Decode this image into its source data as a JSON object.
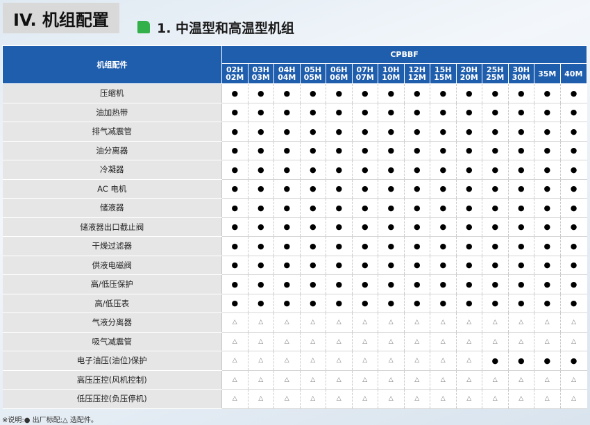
{
  "header": {
    "section": "IV. 机组配置",
    "subtitle": "1. 中温型和高温型机组"
  },
  "table": {
    "corner": "机组配件",
    "group": "CPBBF",
    "models": [
      [
        "02H",
        "02M"
      ],
      [
        "03H",
        "03M"
      ],
      [
        "04H",
        "04M"
      ],
      [
        "05H",
        "05M"
      ],
      [
        "06H",
        "06M"
      ],
      [
        "07H",
        "07M"
      ],
      [
        "10H",
        "10M"
      ],
      [
        "12H",
        "12M"
      ],
      [
        "15H",
        "15M"
      ],
      [
        "20H",
        "20M"
      ],
      [
        "25H",
        "25M"
      ],
      [
        "30H",
        "30M"
      ],
      [
        "35M"
      ],
      [
        "40M"
      ]
    ],
    "rows": [
      {
        "label": "压缩机",
        "cells": [
          "●",
          "●",
          "●",
          "●",
          "●",
          "●",
          "●",
          "●",
          "●",
          "●",
          "●",
          "●",
          "●",
          "●"
        ]
      },
      {
        "label": "油加热带",
        "cells": [
          "●",
          "●",
          "●",
          "●",
          "●",
          "●",
          "●",
          "●",
          "●",
          "●",
          "●",
          "●",
          "●",
          "●"
        ]
      },
      {
        "label": "排气减震管",
        "cells": [
          "●",
          "●",
          "●",
          "●",
          "●",
          "●",
          "●",
          "●",
          "●",
          "●",
          "●",
          "●",
          "●",
          "●"
        ]
      },
      {
        "label": "油分离器",
        "cells": [
          "●",
          "●",
          "●",
          "●",
          "●",
          "●",
          "●",
          "●",
          "●",
          "●",
          "●",
          "●",
          "●",
          "●"
        ]
      },
      {
        "label": "冷凝器",
        "cells": [
          "●",
          "●",
          "●",
          "●",
          "●",
          "●",
          "●",
          "●",
          "●",
          "●",
          "●",
          "●",
          "●",
          "●"
        ]
      },
      {
        "label": "AC 电机",
        "cells": [
          "●",
          "●",
          "●",
          "●",
          "●",
          "●",
          "●",
          "●",
          "●",
          "●",
          "●",
          "●",
          "●",
          "●"
        ]
      },
      {
        "label": "储液器",
        "cells": [
          "●",
          "●",
          "●",
          "●",
          "●",
          "●",
          "●",
          "●",
          "●",
          "●",
          "●",
          "●",
          "●",
          "●"
        ]
      },
      {
        "label": "储液器出口截止阀",
        "cells": [
          "●",
          "●",
          "●",
          "●",
          "●",
          "●",
          "●",
          "●",
          "●",
          "●",
          "●",
          "●",
          "●",
          "●"
        ]
      },
      {
        "label": "干燥过滤器",
        "cells": [
          "●",
          "●",
          "●",
          "●",
          "●",
          "●",
          "●",
          "●",
          "●",
          "●",
          "●",
          "●",
          "●",
          "●"
        ]
      },
      {
        "label": "供液电磁阀",
        "cells": [
          "●",
          "●",
          "●",
          "●",
          "●",
          "●",
          "●",
          "●",
          "●",
          "●",
          "●",
          "●",
          "●",
          "●"
        ]
      },
      {
        "label": "高/低压保护",
        "cells": [
          "●",
          "●",
          "●",
          "●",
          "●",
          "●",
          "●",
          "●",
          "●",
          "●",
          "●",
          "●",
          "●",
          "●"
        ]
      },
      {
        "label": "高/低压表",
        "cells": [
          "●",
          "●",
          "●",
          "●",
          "●",
          "●",
          "●",
          "●",
          "●",
          "●",
          "●",
          "●",
          "●",
          "●"
        ]
      },
      {
        "label": "气液分离器",
        "cells": [
          "△",
          "△",
          "△",
          "△",
          "△",
          "△",
          "△",
          "△",
          "△",
          "△",
          "△",
          "△",
          "△",
          "△"
        ]
      },
      {
        "label": "吸气减震管",
        "cells": [
          "△",
          "△",
          "△",
          "△",
          "△",
          "△",
          "△",
          "△",
          "△",
          "△",
          "△",
          "△",
          "△",
          "△"
        ]
      },
      {
        "label": "电子油压(油位)保护",
        "cells": [
          "△",
          "△",
          "△",
          "△",
          "△",
          "△",
          "△",
          "△",
          "△",
          "△",
          "●",
          "●",
          "●",
          "●"
        ]
      },
      {
        "label": "高压压控(风机控制)",
        "cells": [
          "△",
          "△",
          "△",
          "△",
          "△",
          "△",
          "△",
          "△",
          "△",
          "△",
          "△",
          "△",
          "△",
          "△"
        ]
      },
      {
        "label": "低压压控(负压停机)",
        "cells": [
          "△",
          "△",
          "△",
          "△",
          "△",
          "△",
          "△",
          "△",
          "△",
          "△",
          "△",
          "△",
          "△",
          "△"
        ]
      }
    ]
  },
  "footnote": "※说明:● 出厂标配;△ 选配件。",
  "colors": {
    "header_bg": "#1f5dad",
    "label_bg": "#e6e6e6",
    "accent_green": "#33b04a"
  }
}
